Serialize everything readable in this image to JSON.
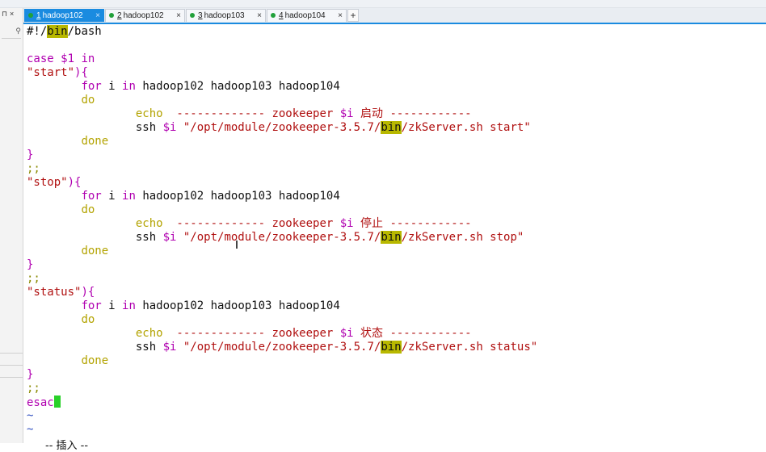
{
  "sidebar": {
    "pin_icon": "pin-icon",
    "close_icon": "close-icon",
    "search_icon": "search-icon"
  },
  "tabs": [
    {
      "num": "1",
      "label": "hadoop102",
      "close": "×",
      "active": true
    },
    {
      "num": "2",
      "label": "hadoop102",
      "close": "×",
      "active": false
    },
    {
      "num": "3",
      "label": "hadoop103",
      "close": "×",
      "active": false
    },
    {
      "num": "4",
      "label": "hadoop104",
      "close": "×",
      "active": false
    }
  ],
  "add_tab_label": "+",
  "script_lines": [
    {
      "segments": [
        {
          "t": "#!/"
        },
        {
          "t": "bin",
          "c": "hl"
        },
        {
          "t": "/bash"
        }
      ]
    },
    {
      "segments": []
    },
    {
      "segments": [
        {
          "t": "case",
          "c": "kw"
        },
        {
          "t": " "
        },
        {
          "t": "$1",
          "c": "kw"
        },
        {
          "t": " "
        },
        {
          "t": "in",
          "c": "kw"
        }
      ]
    },
    {
      "segments": [
        {
          "t": "\"start\"",
          "c": "str"
        },
        {
          "t": ")",
          "c": "kw"
        },
        {
          "t": "{",
          "c": "kw"
        }
      ]
    },
    {
      "segments": [
        {
          "t": "        "
        },
        {
          "t": "for",
          "c": "kw"
        },
        {
          "t": " i "
        },
        {
          "t": "in",
          "c": "kw"
        },
        {
          "t": " hadoop102 hadoop103 hadoop104"
        }
      ]
    },
    {
      "segments": [
        {
          "t": "        "
        },
        {
          "t": "do",
          "c": "cmd"
        }
      ]
    },
    {
      "segments": [
        {
          "t": "                "
        },
        {
          "t": "echo",
          "c": "cmd"
        },
        {
          "t": "  ------------- zookeeper ",
          "c": "str"
        },
        {
          "t": "$i",
          "c": "kw"
        },
        {
          "t": " 启动 ------------",
          "c": "str"
        }
      ]
    },
    {
      "segments": [
        {
          "t": "                ssh "
        },
        {
          "t": "$i",
          "c": "kw"
        },
        {
          "t": " "
        },
        {
          "t": "\"/opt/module/zookeeper-3.5.7/",
          "c": "str"
        },
        {
          "t": "bin",
          "c": "hl"
        },
        {
          "t": "/zkServer.sh start\"",
          "c": "str"
        }
      ]
    },
    {
      "segments": [
        {
          "t": "        "
        },
        {
          "t": "done",
          "c": "cmd"
        }
      ]
    },
    {
      "segments": [
        {
          "t": "}",
          "c": "kw"
        }
      ]
    },
    {
      "segments": [
        {
          "t": ";;",
          "c": "sp"
        }
      ]
    },
    {
      "segments": [
        {
          "t": "\"stop\"",
          "c": "str"
        },
        {
          "t": ")",
          "c": "kw"
        },
        {
          "t": "{",
          "c": "kw"
        }
      ]
    },
    {
      "segments": [
        {
          "t": "        "
        },
        {
          "t": "for",
          "c": "kw"
        },
        {
          "t": " i "
        },
        {
          "t": "in",
          "c": "kw"
        },
        {
          "t": " hadoop102 hadoop103 hadoop104"
        }
      ]
    },
    {
      "segments": [
        {
          "t": "        "
        },
        {
          "t": "do",
          "c": "cmd"
        }
      ]
    },
    {
      "segments": [
        {
          "t": "                "
        },
        {
          "t": "echo",
          "c": "cmd"
        },
        {
          "t": "  ------------- zookeeper ",
          "c": "str"
        },
        {
          "t": "$i",
          "c": "kw"
        },
        {
          "t": " 停止 ------------",
          "c": "str"
        }
      ]
    },
    {
      "segments": [
        {
          "t": "                ssh "
        },
        {
          "t": "$i",
          "c": "kw"
        },
        {
          "t": " "
        },
        {
          "t": "\"/opt/module/zookeeper-3.5.7/",
          "c": "str"
        },
        {
          "t": "bin",
          "c": "hl"
        },
        {
          "t": "/zkServer.sh stop\"",
          "c": "str"
        }
      ]
    },
    {
      "segments": [
        {
          "t": "        "
        },
        {
          "t": "done",
          "c": "cmd"
        }
      ]
    },
    {
      "segments": [
        {
          "t": "}",
          "c": "kw"
        }
      ]
    },
    {
      "segments": [
        {
          "t": ";;",
          "c": "sp"
        }
      ]
    },
    {
      "segments": [
        {
          "t": "\"status\"",
          "c": "str"
        },
        {
          "t": ")",
          "c": "kw"
        },
        {
          "t": "{",
          "c": "kw"
        }
      ]
    },
    {
      "segments": [
        {
          "t": "        "
        },
        {
          "t": "for",
          "c": "kw"
        },
        {
          "t": " i "
        },
        {
          "t": "in",
          "c": "kw"
        },
        {
          "t": " hadoop102 hadoop103 hadoop104"
        }
      ]
    },
    {
      "segments": [
        {
          "t": "        "
        },
        {
          "t": "do",
          "c": "cmd"
        }
      ]
    },
    {
      "segments": [
        {
          "t": "                "
        },
        {
          "t": "echo",
          "c": "cmd"
        },
        {
          "t": "  ------------- zookeeper ",
          "c": "str"
        },
        {
          "t": "$i",
          "c": "kw"
        },
        {
          "t": " 状态 ------------",
          "c": "str"
        }
      ]
    },
    {
      "segments": [
        {
          "t": "                ssh "
        },
        {
          "t": "$i",
          "c": "kw"
        },
        {
          "t": " "
        },
        {
          "t": "\"/opt/module/zookeeper-3.5.7/",
          "c": "str"
        },
        {
          "t": "bin",
          "c": "hl"
        },
        {
          "t": "/zkServer.sh status\"",
          "c": "str"
        }
      ]
    },
    {
      "segments": [
        {
          "t": "        "
        },
        {
          "t": "done",
          "c": "cmd"
        }
      ]
    },
    {
      "segments": [
        {
          "t": "}",
          "c": "kw"
        }
      ]
    },
    {
      "segments": [
        {
          "t": ";;",
          "c": "sp"
        }
      ]
    },
    {
      "segments": [
        {
          "t": "esac",
          "c": "kw"
        }
      ],
      "cursor": true
    },
    {
      "segments": [
        {
          "t": "~",
          "c": "tilde"
        }
      ]
    },
    {
      "segments": [
        {
          "t": "~",
          "c": "tilde"
        }
      ]
    }
  ],
  "vim_mode": "-- 插入 --",
  "colors": {
    "accent": "#1a8be0",
    "keyword": "#b000b0",
    "string": "#b01010",
    "highlight": "#b8b800",
    "cursor": "#2ad12a"
  }
}
